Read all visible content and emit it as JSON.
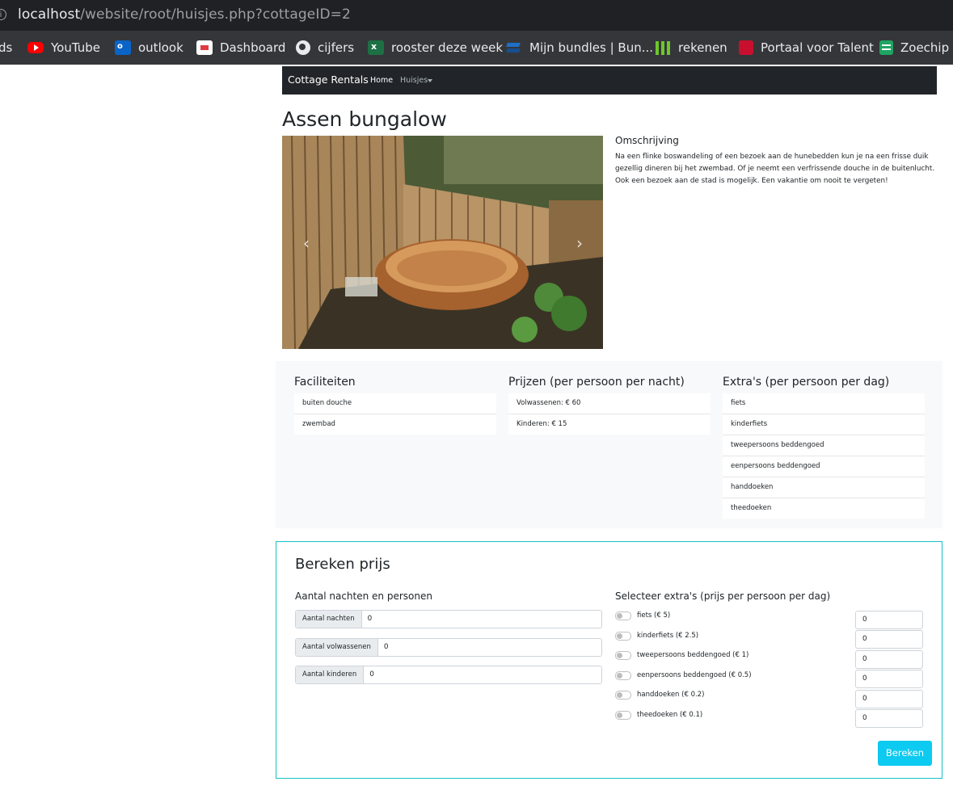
{
  "browser": {
    "url_host": "localhost",
    "url_path": "/website/root/huisjes.php?cottageID=2",
    "bookmarks": [
      {
        "label": "ds",
        "icon": "",
        "color": ""
      },
      {
        "label": "YouTube",
        "icon": "youtube-icon",
        "color": "#ff0000"
      },
      {
        "label": "outlook",
        "icon": "outlook-icon",
        "color": "#0a64c8"
      },
      {
        "label": "Dashboard",
        "icon": "dashboard-icon",
        "color": "#e03a3e"
      },
      {
        "label": "cijfers",
        "icon": "globe-icon",
        "color": "#e8eaed"
      },
      {
        "label": "rooster deze week",
        "icon": "excel-icon",
        "color": "#1d7044"
      },
      {
        "label": "Mijn bundles | Bun...",
        "icon": "layers-icon",
        "color": "#1f6fc5"
      },
      {
        "label": "rekenen",
        "icon": "bars-icon",
        "color": "#6ec62b"
      },
      {
        "label": "Portaal voor Talent",
        "icon": "portaal-icon",
        "color": "#c8102e"
      },
      {
        "label": "Zoechip -",
        "icon": "sheets-icon",
        "color": "#1fa463"
      }
    ]
  },
  "navbar": {
    "brand": "Cottage Rentals",
    "home": "Home",
    "huisjes": "Huisjes"
  },
  "cottage": {
    "title": "Assen bungalow",
    "desc_title": "Omschrijving",
    "desc_text": "Na een flinke boswandeling of een bezoek aan de hunebedden kun je na een frisse duik gezellig dineren bij het zwembad. Of je neemt een verfrissende douche in de buitenlucht. Ook een bezoek aan de stad is mogelijk. Een vakantie om nooit te vergeten!"
  },
  "faciliteiten": {
    "title": "Faciliteiten",
    "items": [
      "buiten douche",
      "zwembad"
    ]
  },
  "prijzen": {
    "title": "Prijzen (per persoon per nacht)",
    "items": [
      "Volwassenen: € 60",
      "Kinderen: € 15"
    ]
  },
  "extras": {
    "title": "Extra's (per persoon per dag)",
    "items": [
      "fiets",
      "kinderfiets",
      "tweepersoons beddengoed",
      "eenpersoons beddengoed",
      "handdoeken",
      "theedoeken"
    ]
  },
  "calc": {
    "title": "Bereken prijs",
    "left_title": "Aantal nachten en personen",
    "right_title": "Selecteer extra's (prijs per persoon per dag)",
    "inputs": [
      {
        "label": "Aantal nachten",
        "value": "0"
      },
      {
        "label": "Aantal volwassenen",
        "value": "0"
      },
      {
        "label": "Aantal kinderen",
        "value": "0"
      }
    ],
    "extras": [
      {
        "label": "fiets (€ 5)",
        "value": "0"
      },
      {
        "label": "kinderfiets (€ 2.5)",
        "value": "0"
      },
      {
        "label": "tweepersoons beddengoed (€ 1)",
        "value": "0"
      },
      {
        "label": "eenpersoons beddengoed (€ 0.5)",
        "value": "0"
      },
      {
        "label": "handdoeken (€ 0.2)",
        "value": "0"
      },
      {
        "label": "theedoeken (€ 0.1)",
        "value": "0"
      }
    ],
    "button": "Bereken"
  }
}
